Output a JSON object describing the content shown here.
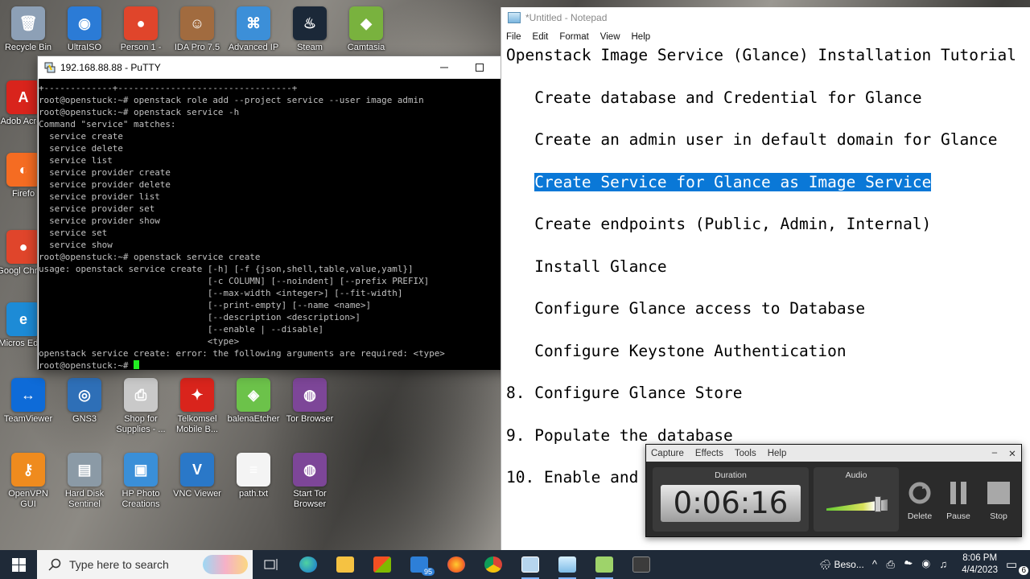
{
  "desktop": {
    "icons": [
      {
        "label": "Recycle Bin",
        "color": "#8da0b6",
        "glyph": "🗑"
      },
      {
        "label": "UltraISO",
        "color": "#2b7bd6",
        "glyph": "◉"
      },
      {
        "label": "Person 1 -",
        "color": "#e0452b",
        "glyph": "●"
      },
      {
        "label": "IDA Pro 7.5",
        "color": "#a16b3f",
        "glyph": "☺"
      },
      {
        "label": "Advanced IP",
        "color": "#3c8fd8",
        "glyph": "⌘"
      },
      {
        "label": "Steam",
        "color": "#1b2838",
        "glyph": "♨"
      },
      {
        "label": "Camtasia",
        "color": "#79b23e",
        "glyph": "◆"
      },
      {
        "label": "Adob Acrob",
        "color": "#d9241c",
        "glyph": "A"
      },
      {
        "label": "Firefo",
        "color": "#f56c22",
        "glyph": "◐"
      },
      {
        "label": "Googl Chrom",
        "color": "#e0452b",
        "glyph": "●"
      },
      {
        "label": "Micros Edge",
        "color": "#1d8bd6",
        "glyph": "e"
      },
      {
        "label": "TeamViewer",
        "color": "#0e6bd8",
        "glyph": "↔"
      },
      {
        "label": "GNS3",
        "color": "#2e6fb7",
        "glyph": "◎"
      },
      {
        "label": "Shop for Supplies - ...",
        "color": "#c9c9c9",
        "glyph": "⎙"
      },
      {
        "label": "Telkomsel Mobile B...",
        "color": "#d9241c",
        "glyph": "✦"
      },
      {
        "label": "balenaEtcher",
        "color": "#6cc24a",
        "glyph": "◈"
      },
      {
        "label": "Tor Browser",
        "color": "#7d4698",
        "glyph": "◍"
      },
      {
        "label": "OpenVPN GUI",
        "color": "#ef8b1e",
        "glyph": "⚷"
      },
      {
        "label": "Hard Disk Sentinel",
        "color": "#8b9aa6",
        "glyph": "▤"
      },
      {
        "label": "HP Photo Creations",
        "color": "#3a8fd8",
        "glyph": "▣"
      },
      {
        "label": "VNC Viewer",
        "color": "#2a78c8",
        "glyph": "V"
      },
      {
        "label": "path.txt",
        "color": "#f4f4f4",
        "glyph": "≡"
      },
      {
        "label": "Start Tor Browser",
        "color": "#7d4698",
        "glyph": "◍"
      }
    ]
  },
  "putty": {
    "title": "192.168.88.88 - PuTTY",
    "lines": [
      "+-------------+---------------------------------+",
      "root@openstuck:~# openstack role add --project service --user image admin",
      "root@openstuck:~# openstack service -h",
      "Command \"service\" matches:",
      "  service create",
      "  service delete",
      "  service list",
      "  service provider create",
      "  service provider delete",
      "  service provider list",
      "  service provider set",
      "  service provider show",
      "  service set",
      "  service show",
      "root@openstuck:~# openstack service create",
      "usage: openstack service create [-h] [-f {json,shell,table,value,yaml}]",
      "                                [-c COLUMN] [--noindent] [--prefix PREFIX]",
      "                                [--max-width <integer>] [--fit-width]",
      "                                [--print-empty] [--name <name>]",
      "                                [--description <description>]",
      "                                [--enable | --disable]",
      "                                <type>",
      "openstack service create: error: the following arguments are required: <type>"
    ],
    "prompt": "root@openstuck:~# "
  },
  "notepad": {
    "title": "*Untitled - Notepad",
    "menu": [
      "File",
      "Edit",
      "Format",
      "View",
      "Help"
    ],
    "lines": [
      {
        "text": "Openstack Image Service (Glance) Installation Tutorial"
      },
      {
        "text": "   Create database and Credential for Glance"
      },
      {
        "text": "   Create an admin user in default domain for Glance"
      },
      {
        "pre": "   ",
        "sel": "Create Service for Glance as Image Service"
      },
      {
        "text": "   Create endpoints (Public, Admin, Internal)"
      },
      {
        "text": "   Install Glance"
      },
      {
        "text": "   Configure Glance access to Database"
      },
      {
        "text": "   Configure Keystone Authentication"
      },
      {
        "text": "8. Configure Glance Store"
      },
      {
        "text": "9. Populate the database"
      },
      {
        "text": "10. Enable and"
      }
    ]
  },
  "recorder": {
    "menu": [
      "Capture",
      "Effects",
      "Tools",
      "Help"
    ],
    "duration_label": "Duration",
    "duration": "0:06:16",
    "audio_label": "Audio",
    "delete_label": "Delete",
    "pause_label": "Pause",
    "stop_label": "Stop"
  },
  "taskbar": {
    "search_placeholder": "Type here to search",
    "mail_badge": "95",
    "weather": "Beso...",
    "time": "8:06 PM",
    "date": "4/4/2023",
    "notifications": "6"
  },
  "colors": {
    "selection": "#0a78d7",
    "taskbar": "#1f2a38",
    "terminal_bg": "#000000",
    "terminal_fg": "#c0c0c0",
    "cursor": "#22ee22"
  }
}
